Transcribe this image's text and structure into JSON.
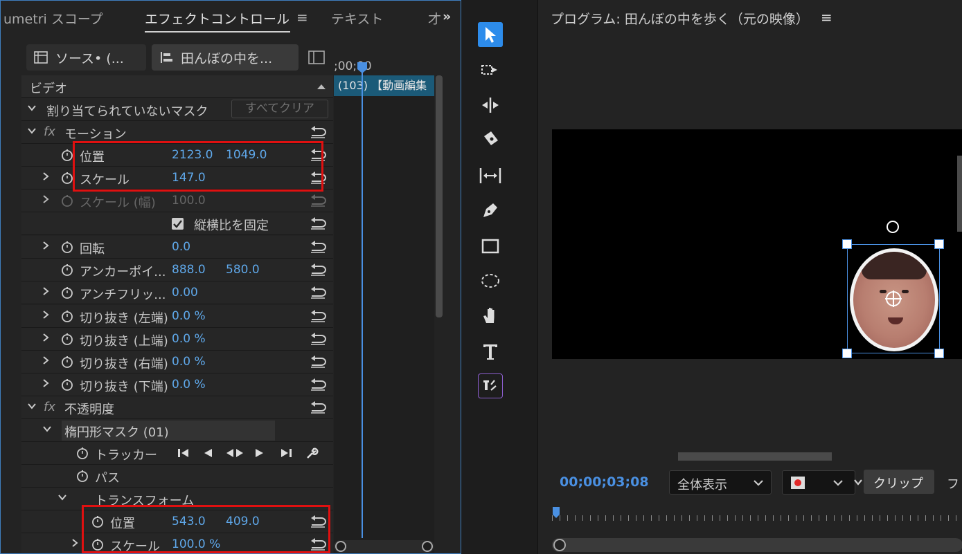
{
  "left_panel": {
    "tabs": [
      {
        "label": "umetri スコープ"
      },
      {
        "label": "エフェクトコントロール",
        "menu_icon": "≡"
      },
      {
        "label": "テキスト"
      },
      {
        "label": "才"
      }
    ],
    "source_button": "ソース• (...",
    "clip_button": "田んぼの中を...",
    "video_header": "ビデオ",
    "timeline_ruler": ";00;00",
    "timeline_clip": "(103) 【動画編集",
    "unassigned_mask": "割り当てられていないマスク",
    "clear_all": "すべてクリア",
    "motion": {
      "label": "モーション",
      "fx": "fx",
      "position": {
        "label": "位置",
        "x": "2123.0",
        "y": "1049.0"
      },
      "scale": {
        "label": "スケール",
        "value": "147.0"
      },
      "scale_width": {
        "label": "スケール (幅)",
        "value": "100.0"
      },
      "uniform": {
        "label": "縦横比を固定",
        "checked": true
      },
      "rotation": {
        "label": "回転",
        "value": "0.0"
      },
      "anchor": {
        "label": "アンカーポイ...",
        "x": "888.0",
        "y": "580.0"
      },
      "antiflicker": {
        "label": "アンチフリッ...",
        "value": "0.00"
      },
      "crop_left": {
        "label": "切り抜き (左端)",
        "value": "0.0 %"
      },
      "crop_top": {
        "label": "切り抜き (上端)",
        "value": "0.0 %"
      },
      "crop_right": {
        "label": "切り抜き (右端)",
        "value": "0.0 %"
      },
      "crop_bottom": {
        "label": "切り抜き (下端)",
        "value": "0.0 %"
      }
    },
    "opacity": {
      "label": "不透明度",
      "fx": "fx",
      "mask": {
        "label": "楕円形マスク (01)"
      },
      "tracker": "トラッカー",
      "path": "パス",
      "transform": {
        "label": "トランスフォーム",
        "position": {
          "label": "位置",
          "x": "543.0",
          "y": "409.0"
        },
        "scale": {
          "label": "スケール",
          "value": "100.0 %"
        }
      }
    },
    "highlight_color": "#e01010",
    "value_color": "#5fa8ea"
  },
  "tools": [
    "selection-tool",
    "track-select-tool",
    "ripple-edit-tool",
    "razor-tool",
    "slip-tool",
    "pen-tool",
    "rectangle-tool",
    "ellipse-tool",
    "hand-tool",
    "type-tool",
    "caption-tool"
  ],
  "program_monitor": {
    "title": "プログラム: 田んぼの中を歩く（元の映像）",
    "menu_icon": "≡",
    "timecode": "00;00;03;08",
    "zoom": "全体表示",
    "clip_tab": "クリップ",
    "next_tab": "フレ",
    "accent_color": "#4a90e2"
  }
}
